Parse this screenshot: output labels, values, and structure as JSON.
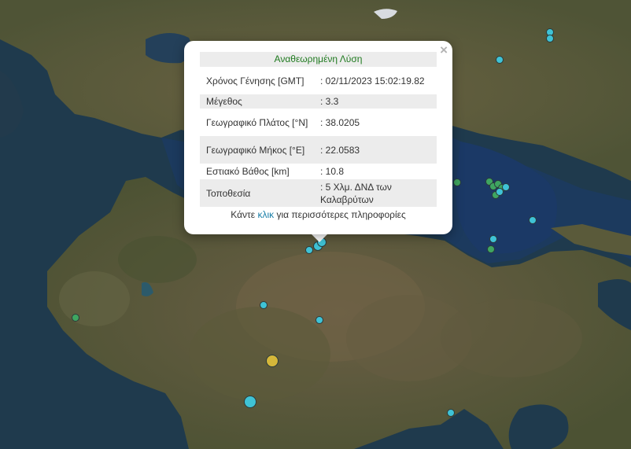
{
  "popup": {
    "title": "Αναθεωρημένη Λύση",
    "close_label": "×",
    "rows": [
      {
        "label": "Χρόνος Γένησης [GMT]",
        "value": ": 02/11/2023 15:02:19.82"
      },
      {
        "label": "Μέγεθος",
        "value": ": 3.3"
      },
      {
        "label": "Γεωγραφικό Πλάτος [°N]",
        "value": ": 38.0205"
      },
      {
        "label": "Γεωγραφικό Μήκος [°E]",
        "value": ": 22.0583"
      },
      {
        "label": "Εστιακό Βάθος [km]",
        "value": ": 10.8"
      },
      {
        "label": "Τοποθεσία",
        "value": ": 5 Χλμ. ΔΝΔ των Καλαβρύτων"
      }
    ],
    "more_prefix": "Κάντε",
    "more_link": "κλικ",
    "more_suffix": "για περισσότερες πληροφορίες"
  },
  "colors": {
    "sea": "#1d3a4f",
    "gulf": "#1e3e63",
    "land": "#5b5a3a",
    "mountain": "#6e6346",
    "marker_cyan": "#3fc3d6",
    "marker_green": "#3fa661",
    "marker_yellow": "#d5b73a",
    "popup_title": "#1f7a1f",
    "link": "#1a7fa8"
  }
}
